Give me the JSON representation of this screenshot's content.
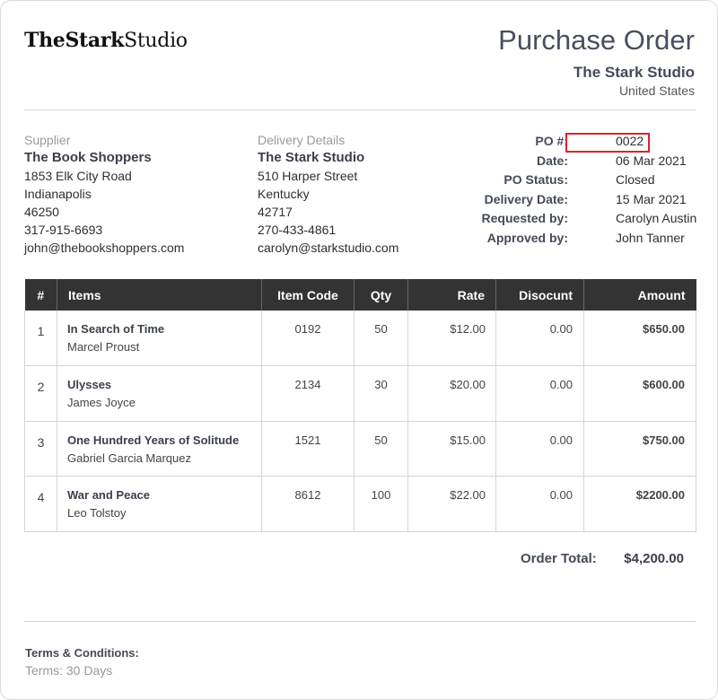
{
  "logo": {
    "bold": "TheStark",
    "light": "Studio"
  },
  "title": "Purchase Order",
  "company": {
    "name": "The Stark Studio",
    "country": "United States"
  },
  "supplier": {
    "label": "Supplier",
    "name": "The Book Shoppers",
    "street": "1853 Elk City Road",
    "city": "Indianapolis",
    "zip": "46250",
    "phone": "317-915-6693",
    "email": "john@thebookshoppers.com"
  },
  "delivery": {
    "label": "Delivery Details",
    "name": "The Stark Studio",
    "street": "510 Harper Street",
    "state": "Kentucky",
    "zip": "42717",
    "phone": "270-433-4861",
    "email": "carolyn@starkstudio.com"
  },
  "meta": [
    {
      "label": "PO #:",
      "value": "0022"
    },
    {
      "label": "Date:",
      "value": "06 Mar 2021"
    },
    {
      "label": "PO Status:",
      "value": "Closed"
    },
    {
      "label": "Delivery Date:",
      "value": "15 Mar 2021"
    },
    {
      "label": "Requested by:",
      "value": "Carolyn Austin"
    },
    {
      "label": "Approved by:",
      "value": "John Tanner"
    }
  ],
  "highlight_color": "#d8242b",
  "table": {
    "headers": [
      "#",
      "Items",
      "Item Code",
      "Qty",
      "Rate",
      "Disocunt",
      "Amount"
    ],
    "rows": [
      {
        "num": "1",
        "item": "In Search of Time",
        "author": "Marcel Proust",
        "code": "0192",
        "qty": "50",
        "rate": "$12.00",
        "discount": "0.00",
        "amount": "$650.00"
      },
      {
        "num": "2",
        "item": "Ulysses",
        "author": "James Joyce",
        "code": "2134",
        "qty": "30",
        "rate": "$20.00",
        "discount": "0.00",
        "amount": "$600.00"
      },
      {
        "num": "3",
        "item": "One Hundred Years of Solitude",
        "author": "Gabriel Garcia Marquez",
        "code": "1521",
        "qty": "50",
        "rate": "$15.00",
        "discount": "0.00",
        "amount": "$750.00"
      },
      {
        "num": "4",
        "item": "War and Peace",
        "author": "Leo Tolstoy",
        "code": "8612",
        "qty": "100",
        "rate": "$22.00",
        "discount": "0.00",
        "amount": "$2200.00"
      }
    ]
  },
  "total": {
    "label": "Order Total:",
    "value": "$4,200.00"
  },
  "terms": {
    "heading": "Terms & Conditions:",
    "text": "Terms: 30 Days"
  }
}
